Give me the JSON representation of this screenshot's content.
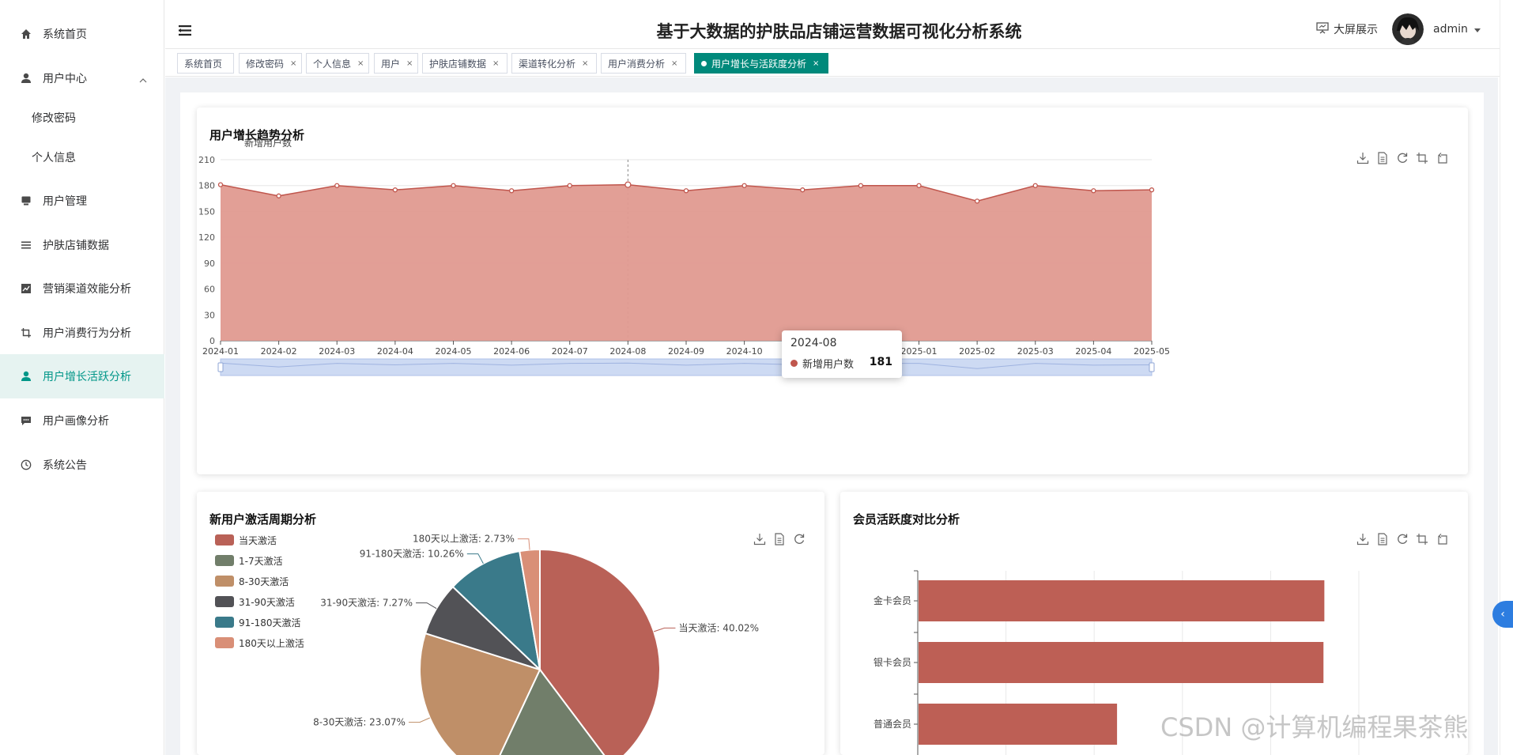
{
  "header": {
    "title": "基于大数据的护肤品店铺运营数据可视化分析系统",
    "bigscreen_label": "大屏展示",
    "username": "admin"
  },
  "sidebar": {
    "items": [
      {
        "label": "系统首页",
        "icon": "home-icon"
      },
      {
        "label": "用户中心",
        "icon": "user-icon"
      },
      {
        "label": "修改密码",
        "icon": ""
      },
      {
        "label": "个人信息",
        "icon": ""
      },
      {
        "label": "用户管理",
        "icon": "monitor-icon"
      },
      {
        "label": "护肤店铺数据",
        "icon": "list-icon"
      },
      {
        "label": "营销渠道效能分析",
        "icon": "chart-icon"
      },
      {
        "label": "用户消费行为分析",
        "icon": "crop-icon"
      },
      {
        "label": "用户增长活跃分析",
        "icon": "user-icon"
      },
      {
        "label": "用户画像分析",
        "icon": "message-icon"
      },
      {
        "label": "系统公告",
        "icon": "clock-icon"
      }
    ],
    "active_index": 8
  },
  "tabs": [
    {
      "label": "系统首页"
    },
    {
      "label": "修改密码"
    },
    {
      "label": "个人信息"
    },
    {
      "label": "用户"
    },
    {
      "label": "护肤店铺数据"
    },
    {
      "label": "渠道转化分析"
    },
    {
      "label": "用户消费分析"
    },
    {
      "label": "用户增长与活跃度分析",
      "active": true
    }
  ],
  "cards": {
    "growth": {
      "title": "用户增长趋势分析"
    },
    "activation": {
      "title": "新用户激活周期分析"
    },
    "membership": {
      "title": "会员活跃度对比分析"
    }
  },
  "tooltip": {
    "title": "2024-08",
    "series": "新增用户数",
    "value": "181"
  },
  "colors": {
    "primary": "#009688",
    "accent_red": "#c0564d",
    "area_fill": "#e09a90"
  },
  "chart_data": [
    {
      "type": "area",
      "title": "用户增长趋势分析",
      "ylabel": "新增用户数",
      "xlabel": "",
      "categories": [
        "2024-01",
        "2024-02",
        "2024-03",
        "2024-04",
        "2024-05",
        "2024-06",
        "2024-07",
        "2024-08",
        "2024-09",
        "2024-10",
        "2024-11",
        "2024-12",
        "2025-01",
        "2025-02",
        "2025-03",
        "2025-04",
        "2025-05"
      ],
      "series": [
        {
          "name": "新增用户数",
          "values": [
            181,
            168,
            180,
            175,
            180,
            174,
            180,
            181,
            174,
            180,
            175,
            180,
            180,
            162,
            180,
            174,
            175
          ]
        }
      ],
      "yticks": [
        "0",
        "30",
        "60",
        "90",
        "120",
        "150",
        "180",
        "210"
      ],
      "ylim": [
        0,
        210
      ],
      "grid": true
    },
    {
      "type": "pie",
      "title": "新用户激活周期分析",
      "legend": "left",
      "slices": [
        {
          "name": "当天激活",
          "value": 40.02,
          "label": "当天激活: 40.02%",
          "color": "#b96157"
        },
        {
          "name": "1-7天激活",
          "value": 17.35,
          "label": "",
          "color": "#717e6a"
        },
        {
          "name": "8-30天激活",
          "value": 23.07,
          "label": "8-30天激活: 23.07%",
          "color": "#bf8f68"
        },
        {
          "name": "31-90天激活",
          "value": 7.27,
          "label": "31-90天激活: 7.27%",
          "color": "#525256"
        },
        {
          "name": "91-180天激活",
          "value": 10.26,
          "label": "91-180天激活: 10.26%",
          "color": "#3a7a8a"
        },
        {
          "name": "180天以上激活",
          "value": 2.73,
          "label": "180天以上激活: 2.73%",
          "color": "#d98f77"
        }
      ]
    },
    {
      "type": "bar",
      "title": "会员活跃度对比分析",
      "orientation": "horizontal",
      "categories": [
        "金卡会员",
        "银卡会员",
        "普通会员"
      ],
      "values": [
        0.92,
        0.918,
        0.45
      ],
      "color": "#bd5f55",
      "grid": true
    }
  ]
}
